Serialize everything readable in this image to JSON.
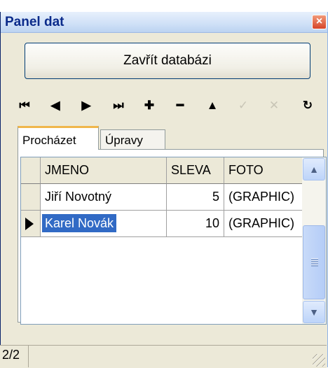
{
  "window": {
    "title": "Panel dat",
    "close_glyph": "×"
  },
  "buttons": {
    "close_db": "Zavřít databázi"
  },
  "navigator": [
    {
      "name": "first-record-button",
      "glyph": "⏮",
      "disabled": false
    },
    {
      "name": "prior-record-button",
      "glyph": "◀",
      "disabled": false
    },
    {
      "name": "next-record-button",
      "glyph": "▶",
      "disabled": false
    },
    {
      "name": "last-record-button",
      "glyph": "⏭",
      "disabled": false
    },
    {
      "name": "insert-record-button",
      "glyph": "✚",
      "disabled": false
    },
    {
      "name": "delete-record-button",
      "glyph": "━",
      "disabled": false
    },
    {
      "name": "edit-record-button",
      "glyph": "▲",
      "disabled": false
    },
    {
      "name": "post-edit-button",
      "glyph": "✓",
      "disabled": true
    },
    {
      "name": "cancel-edit-button",
      "glyph": "✕",
      "disabled": true
    },
    {
      "name": "refresh-button",
      "glyph": "↻",
      "disabled": false
    }
  ],
  "tabs": [
    {
      "label": "Procházet",
      "active": true
    },
    {
      "label": "Úpravy",
      "active": false
    }
  ],
  "grid": {
    "columns": [
      "JMENO",
      "SLEVA",
      "FOTO"
    ],
    "rows": [
      {
        "jmeno": "Jiří Novotný",
        "sleva": "5",
        "foto": "(GRAPHIC)",
        "current": false
      },
      {
        "jmeno": "Karel Novák",
        "sleva": "10",
        "foto": "(GRAPHIC)",
        "current": true
      }
    ]
  },
  "status": {
    "record_position": "2/2"
  },
  "colors": {
    "selection": "#316ac5",
    "title_text": "#0b2b8b",
    "tab_highlight": "#f0b64b"
  }
}
